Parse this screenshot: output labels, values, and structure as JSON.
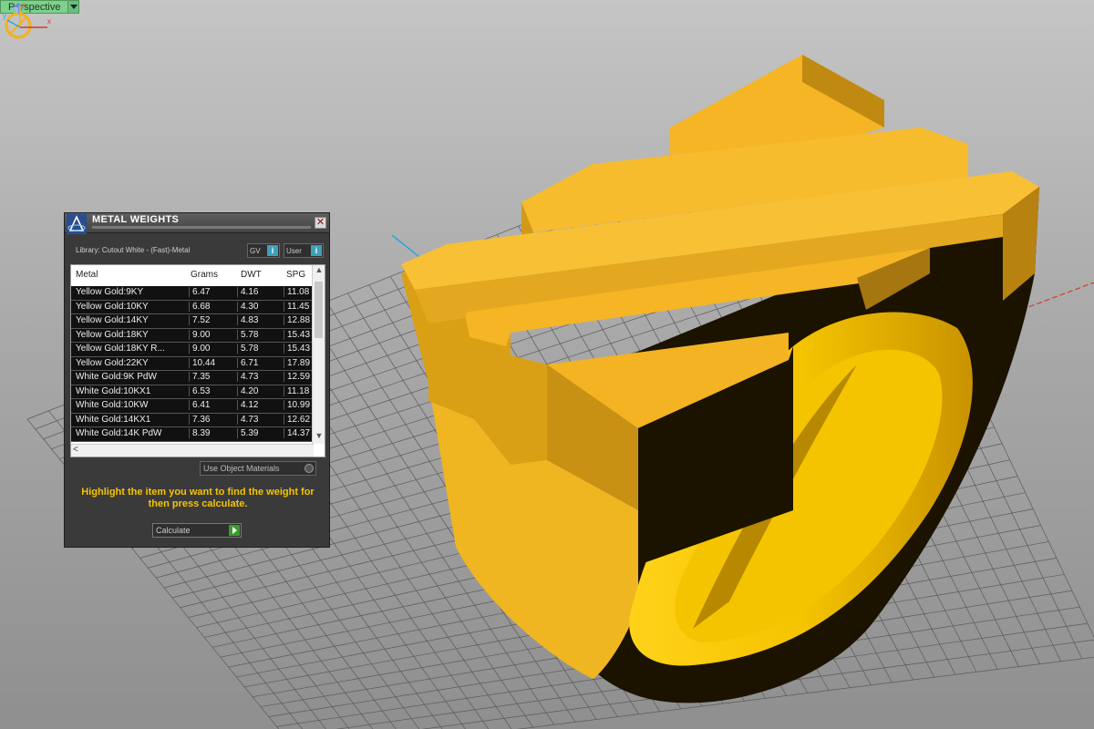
{
  "viewport": {
    "label": "Perspective",
    "colors": {
      "grid": "#5a5a5a",
      "gold_light": "#f5b525",
      "gold_mid": "#d9a016",
      "gold_dark": "#b07c0a",
      "x_axis": "#d43a2a",
      "y_axis": "#2aa8d8"
    }
  },
  "panel": {
    "title": "METAL WEIGHTS",
    "close": "✕",
    "library": "Library: Cutout White - (Fast)-Metal",
    "gv_label": "GV",
    "user_label": "User",
    "info_glyph": "i",
    "columns": {
      "metal": "Metal",
      "grams": "Grams",
      "dwt": "DWT",
      "spg": "SPG"
    },
    "rows": [
      {
        "metal": "Yellow Gold:9KY",
        "grams": "6.47",
        "dwt": "4.16",
        "spg": "11.08"
      },
      {
        "metal": "Yellow Gold:10KY",
        "grams": "6.68",
        "dwt": "4.30",
        "spg": "11.45"
      },
      {
        "metal": "Yellow Gold:14KY",
        "grams": "7.52",
        "dwt": "4.83",
        "spg": "12.88"
      },
      {
        "metal": "Yellow Gold:18KY",
        "grams": "9.00",
        "dwt": "5.78",
        "spg": "15.43"
      },
      {
        "metal": "Yellow Gold:18KY R...",
        "grams": "9.00",
        "dwt": "5.78",
        "spg": "15.43"
      },
      {
        "metal": "Yellow Gold:22KY",
        "grams": "10.44",
        "dwt": "6.71",
        "spg": "17.89"
      },
      {
        "metal": "White Gold:9K PdW",
        "grams": "7.35",
        "dwt": "4.73",
        "spg": "12.59"
      },
      {
        "metal": "White Gold:10KX1",
        "grams": "6.53",
        "dwt": "4.20",
        "spg": "11.18"
      },
      {
        "metal": "White Gold:10KW",
        "grams": "6.41",
        "dwt": "4.12",
        "spg": "10.99"
      },
      {
        "metal": "White Gold:14KX1",
        "grams": "7.36",
        "dwt": "4.73",
        "spg": "12.62"
      },
      {
        "metal": "White Gold:14K PdW",
        "grams": "8.39",
        "dwt": "5.39",
        "spg": "14.37"
      }
    ],
    "scroll_up": "▲",
    "scroll_down": "▼",
    "scroll_left": "<",
    "use_object_materials": "Use Object Materials",
    "hint": "Highlight the item you want to find the weight for then press calculate.",
    "calculate": "Calculate"
  },
  "triad": {
    "z": "z",
    "y": "y",
    "x": "x"
  }
}
